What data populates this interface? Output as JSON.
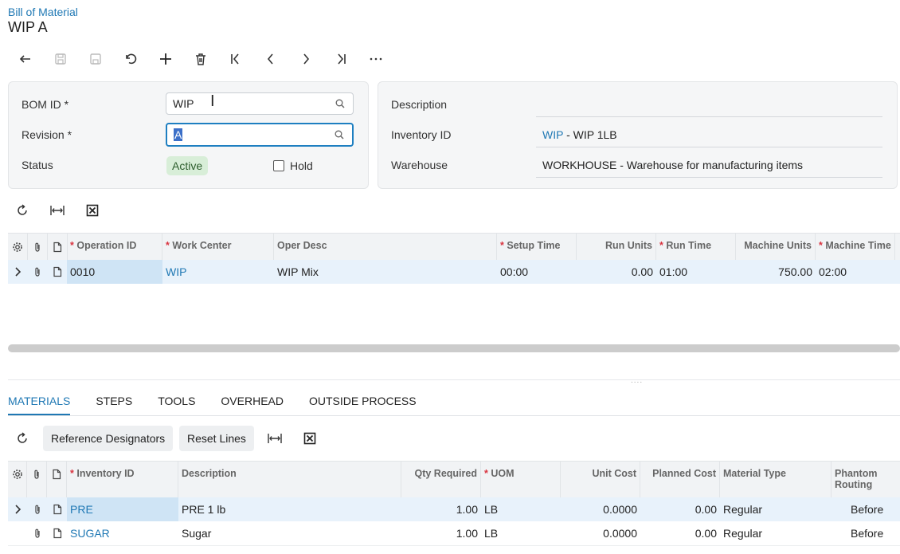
{
  "header": {
    "breadcrumb": "Bill of Material",
    "title": "WIP A"
  },
  "toolbar": {
    "buttons": [
      "back-icon",
      "save-icon",
      "save-close-icon",
      "undo-icon",
      "add-icon",
      "delete-icon",
      "first-icon",
      "prev-icon",
      "next-icon",
      "last-icon",
      "more-icon"
    ]
  },
  "form": {
    "bom_id_label": "BOM ID",
    "bom_id_value": "WIP",
    "revision_label": "Revision",
    "revision_value": "A",
    "status_label": "Status",
    "status_value": "Active",
    "hold_label": "Hold",
    "description_label": "Description",
    "description_value": "",
    "inventory_label": "Inventory ID",
    "inventory_link": "WIP",
    "inventory_rest": " - WIP 1LB",
    "warehouse_label": "Warehouse",
    "warehouse_value": "WORKHOUSE - Warehouse for manufacturing items"
  },
  "ops_grid": {
    "headers": {
      "operation_id": "Operation ID",
      "work_center": "Work Center",
      "oper_desc": "Oper Desc",
      "setup_time": "Setup Time",
      "run_units": "Run Units",
      "run_time": "Run Time",
      "machine_units": "Machine Units",
      "machine_time": "Machine Time"
    },
    "rows": [
      {
        "operation_id": "0010",
        "work_center": "WIP",
        "oper_desc": "WIP Mix",
        "setup_time": "00:00",
        "run_units": "0.00",
        "run_time": "01:00",
        "machine_units": "750.00",
        "machine_time": "02:00"
      }
    ]
  },
  "tabs": [
    "MATERIALS",
    "STEPS",
    "TOOLS",
    "OVERHEAD",
    "OUTSIDE PROCESS"
  ],
  "materials": {
    "ref_designators_label": "Reference Designators",
    "reset_lines_label": "Reset Lines",
    "headers": {
      "inventory_id": "Inventory ID",
      "description": "Description",
      "qty_required": "Qty Required",
      "uom": "UOM",
      "unit_cost": "Unit Cost",
      "planned_cost": "Planned Cost",
      "material_type": "Material Type",
      "phantom_routing_1": "Phantom",
      "phantom_routing_2": "Routing"
    },
    "rows": [
      {
        "inventory_id": "PRE",
        "description": "PRE 1 lb",
        "qty_required": "1.00",
        "uom": "LB",
        "unit_cost": "0.0000",
        "planned_cost": "0.00",
        "material_type": "Regular",
        "phantom_routing": "Before"
      },
      {
        "inventory_id": "SUGAR",
        "description": "Sugar",
        "qty_required": "1.00",
        "uom": "LB",
        "unit_cost": "0.0000",
        "planned_cost": "0.00",
        "material_type": "Regular",
        "phantom_routing": "Before"
      }
    ]
  },
  "colors": {
    "accent": "#1f78b4",
    "selected_row": "#e8f2fb",
    "active_badge": "#d8eed8"
  }
}
